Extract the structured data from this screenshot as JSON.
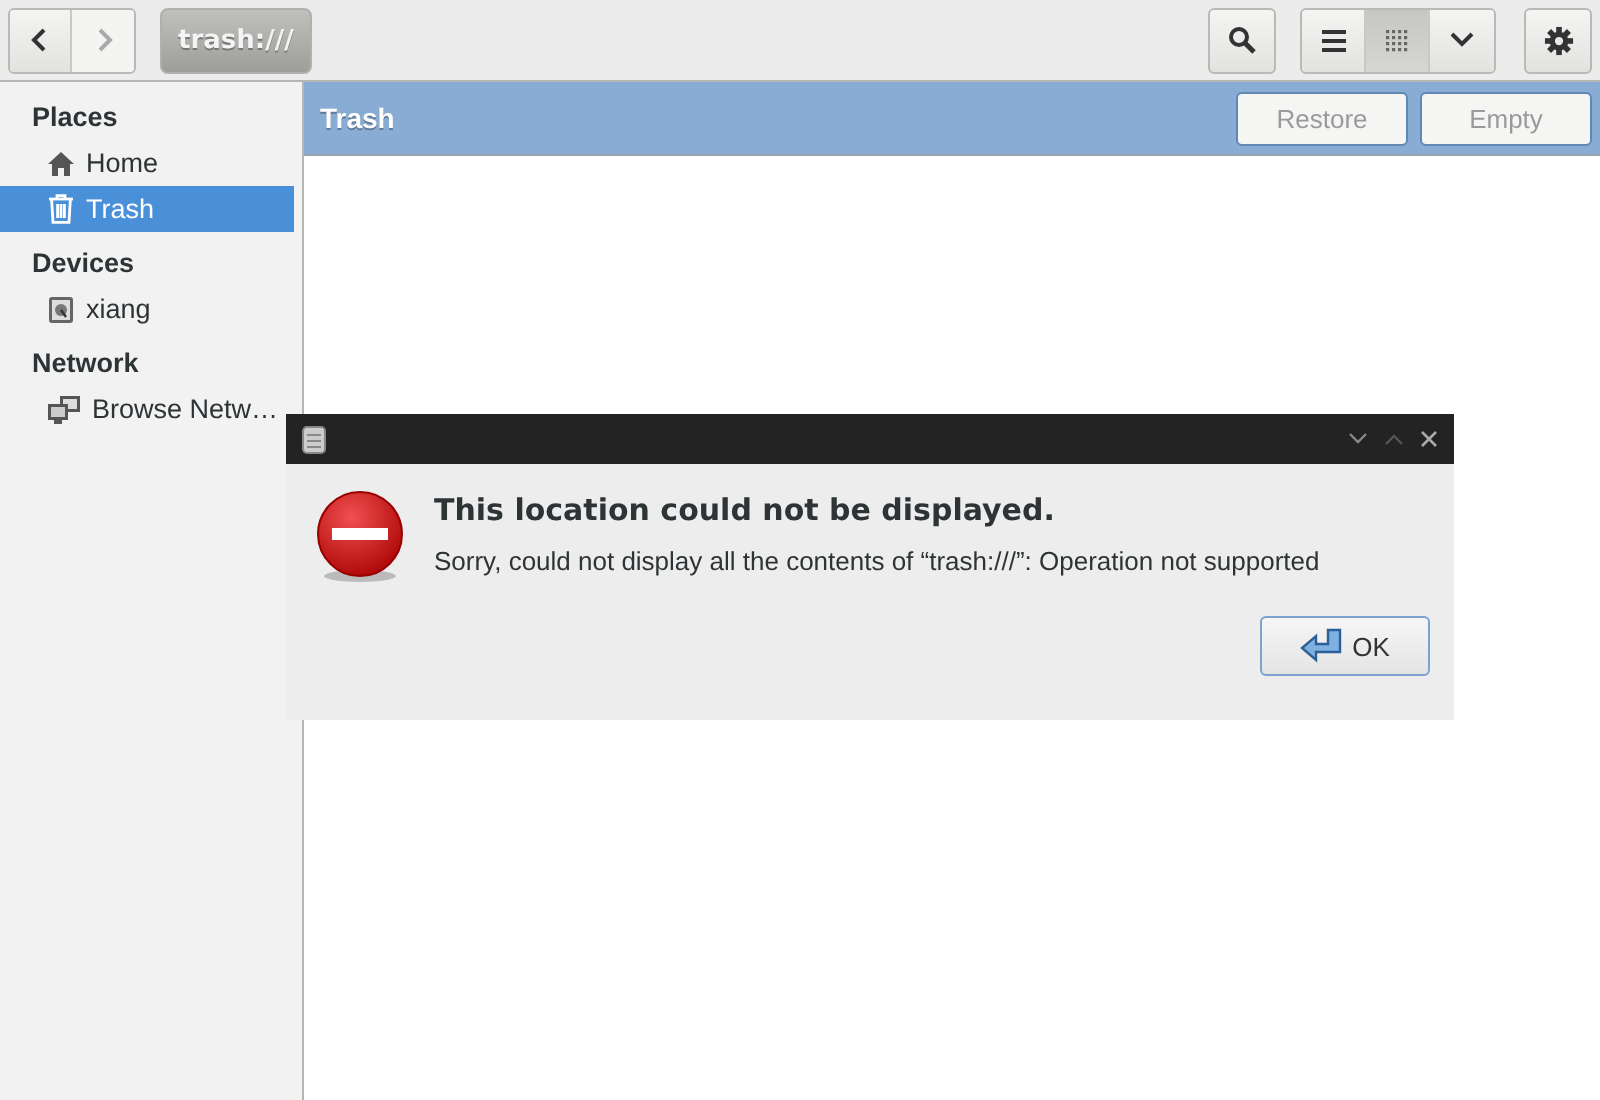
{
  "toolbar": {
    "back_button": {
      "disabled": false
    },
    "forward_button": {
      "disabled": true
    },
    "location": "trash:///",
    "view_buttons": [
      {
        "kind": "list",
        "selected": false
      },
      {
        "kind": "grid",
        "selected": true
      }
    ]
  },
  "sidebar": {
    "sections": [
      {
        "title": "Places",
        "items": [
          {
            "label": "Home",
            "kind": "home",
            "selected": false
          },
          {
            "label": "Trash",
            "kind": "trash",
            "selected": true
          }
        ]
      },
      {
        "title": "Devices",
        "items": [
          {
            "label": "xiang",
            "kind": "drive",
            "selected": false
          }
        ]
      },
      {
        "title": "Network",
        "items": [
          {
            "label": "Browse Netw…",
            "kind": "network",
            "selected": false
          }
        ]
      }
    ]
  },
  "header": {
    "title": "Trash",
    "buttons": [
      {
        "label": "Restore",
        "disabled": true
      },
      {
        "label": "Empty",
        "disabled": true
      }
    ]
  },
  "dialog": {
    "heading": "This location could not be displayed.",
    "message": "Sorry, could not display all the contents of “trash:///”: Operation not supported",
    "button": "OK"
  }
}
